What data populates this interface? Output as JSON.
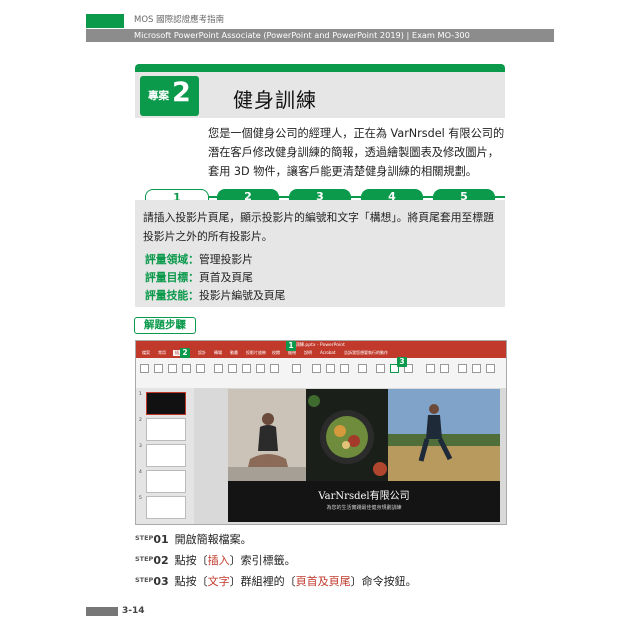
{
  "header": {
    "book_title": "MOS 國際認證應考指南",
    "subtitle": "Microsoft PowerPoint Associate (PowerPoint and PowerPoint 2019) | Exam MO-300"
  },
  "case": {
    "label": "專案",
    "number": "2",
    "title": "健身訓練"
  },
  "intro": "您是一個健身公司的經理人，正在為 VarNrsdel 有限公司的潛在客戶修改健身訓練的簡報，透過繪製圖表及修改圖片，套用 3D 物件，讓客戶能更清楚健身訓練的相關規劃。",
  "steps_tabs": [
    "1",
    "2",
    "3",
    "4",
    "5"
  ],
  "task": {
    "text": "請插入投影片頁尾，顯示投影片的編號和文字「構想」。將頁尾套用至標題投影片之外的所有投影片。",
    "domain_key": "評量領域：",
    "domain_val": "管理投影片",
    "goal_key": "評量目標：",
    "goal_val": "頁首及頁尾",
    "skill_key": "評量技能：",
    "skill_val": "投影片編號及頁尾"
  },
  "solve_label": "解題步驟",
  "screenshot": {
    "window_title": "健身訓練.pptx - PowerPoint",
    "tabs": [
      "檔案",
      "常用",
      "插入",
      "設計",
      "轉場",
      "動畫",
      "投影片放映",
      "校閱",
      "檢視",
      "說明",
      "Acrobat",
      "告訴我您想要執行的動作"
    ],
    "slide_company": "VarNrsdel有限公司",
    "slide_tagline": "為您的生活實踐最佳健身規劃訓練",
    "callouts": [
      "1",
      "2",
      "3"
    ],
    "thumb_numbers": [
      "1",
      "2",
      "3",
      "4",
      "5"
    ]
  },
  "step_list": [
    {
      "step": "STEP",
      "num": "01",
      "pre": "開啟簡報檔案。",
      "hl1": "",
      "mid": "",
      "hl2": "",
      "post": ""
    },
    {
      "step": "STEP",
      "num": "02",
      "pre": "點按〔",
      "hl1": "插入",
      "mid": "〕索引標籤。",
      "hl2": "",
      "post": ""
    },
    {
      "step": "STEP",
      "num": "03",
      "pre": "點按〔",
      "hl1": "文字",
      "mid": "〕群組裡的〔",
      "hl2": "頁首及頁尾",
      "post": "〕命令按鈕。"
    }
  ],
  "footer": {
    "page": "3-14"
  },
  "colors": {
    "accent_green": "#0b9a4c",
    "ppt_red": "#c0392b",
    "panel_gray": "#e6e6e6"
  }
}
